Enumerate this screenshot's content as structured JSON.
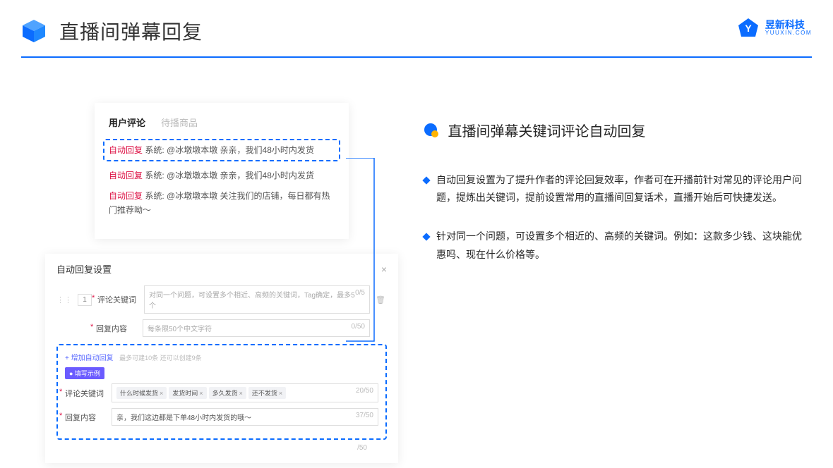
{
  "header": {
    "title": "直播间弹幕回复",
    "brand_cn": "昱新科技",
    "brand_en": "YUUXIN.COM"
  },
  "panel_comments": {
    "tab_active": "用户评论",
    "tab_other": "待播商品",
    "line1_badge": "自动回复",
    "line1_text": " 系统: @冰墩墩本墩 亲亲，我们48小时内发货",
    "line2_badge": "自动回复",
    "line2_text": " 系统: @冰墩墩本墩 亲亲，我们48小时内发货",
    "line3_badge": "自动回复",
    "line3_text": " 系统: @冰墩墩本墩 关注我们的店铺，每日都有热门推荐呦～"
  },
  "panel_settings": {
    "title": "自动回复设置",
    "row_num": "1",
    "kw_label": "评论关键词",
    "kw_placeholder": "对同一个问题，可设置多个相近、高频的关键词，Tag确定，最多5个",
    "kw_count": "0/5",
    "reply_label": "回复内容",
    "reply_placeholder": "每条限50个中文字符",
    "reply_count": "0/50",
    "add_link": "+ 增加自动回复",
    "add_note": "最多可建10条 还可以创建9条",
    "example_pill": "● 填写示例",
    "ex_kw_label": "评论关键词",
    "ex_tags": [
      "什么时候发货",
      "发货时间",
      "多久发货",
      "还不发货"
    ],
    "ex_kw_count": "20/50",
    "ex_reply_label": "回复内容",
    "ex_reply_text": "亲，我们这边都是下单48小时内发货的哦～",
    "ex_reply_count": "37/50",
    "extra_count": "/50"
  },
  "right": {
    "subtitle": "直播间弹幕关键词评论自动回复",
    "bullet1": "自动回复设置为了提升作者的评论回复效率，作者可在开播前针对常见的评论用户问题，提炼出关键词，提前设置常用的直播间回复话术，直播开始后可快捷发送。",
    "bullet2": "针对同一个问题，可设置多个相近的、高频的关键词。例如：这款多少钱、这块能优惠吗、现在什么价格等。"
  }
}
